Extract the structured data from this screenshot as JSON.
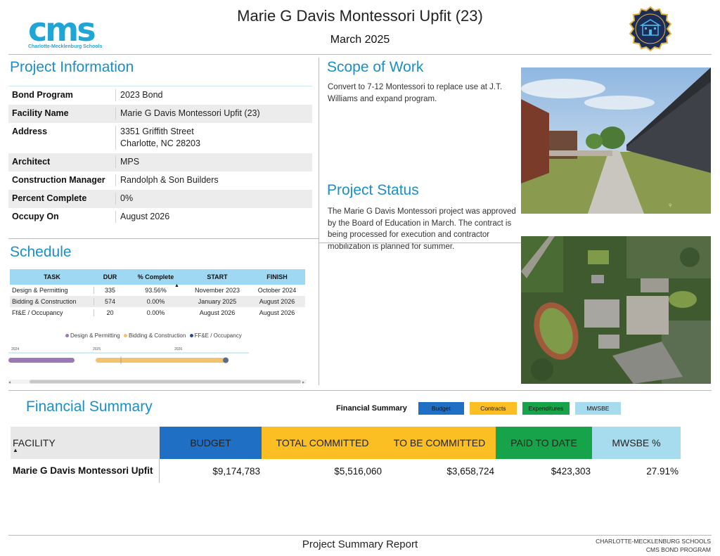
{
  "header": {
    "logo_text": "cms",
    "logo_subtext": "Charlotte-Mecklenburg Schools",
    "title": "Marie G Davis Montessori Upfit (23)",
    "date": "March 2025"
  },
  "project_info": {
    "heading": "Project Information",
    "rows": [
      {
        "label": "Bond Program",
        "value": "2023 Bond"
      },
      {
        "label": "Facility Name",
        "value": "Marie G Davis Montessori Upfit (23)"
      },
      {
        "label": "Address",
        "value": "3351 Griffith Street\nCharlotte, NC 28203"
      },
      {
        "label": "Architect",
        "value": "MPS"
      },
      {
        "label": "Construction Manager",
        "value": "Randolph & Son Builders"
      },
      {
        "label": "Percent Complete",
        "value": "0%"
      },
      {
        "label": "Occupy On",
        "value": "August 2026"
      }
    ]
  },
  "schedule": {
    "heading": "Schedule",
    "columns": [
      "TASK",
      "DUR",
      "% Complete",
      "START",
      "FINISH"
    ],
    "rows": [
      {
        "task": "Design & Permitting",
        "dur": "335",
        "pct": "93.56%",
        "start": "November 2023",
        "finish": "October 2024"
      },
      {
        "task": "Bidding & Construction",
        "dur": "574",
        "pct": "0.00%",
        "start": "January 2025",
        "finish": "August 2026"
      },
      {
        "task": "Ff&E / Occupancy",
        "dur": "20",
        "pct": "0.00%",
        "start": "August 2026",
        "finish": "August 2026"
      }
    ],
    "legend": [
      {
        "label": "Design & Permitting",
        "color": "#9b79b5"
      },
      {
        "label": "Bidding & Construction",
        "color": "#f2c26e"
      },
      {
        "label": "FF&E / Occupancy",
        "color": "#2f4a8a"
      }
    ],
    "timeline_ticks": [
      "2024",
      "2025",
      "2026"
    ]
  },
  "scope": {
    "heading": "Scope of Work",
    "text": "Convert to 7-12 Montessori to replace use at J.T. Williams and expand program."
  },
  "status": {
    "heading": "Project Status",
    "text": "The Marie G Davis Montessori project was approved by the Board of Education in March. The contract is being processed for execution and contractor mobilization is planned for summer."
  },
  "financial": {
    "heading": "Financial Summary",
    "legend_label": "Financial Summary",
    "legend": [
      {
        "label": "Budget",
        "color": "#1f6fc4"
      },
      {
        "label": "Contracts",
        "color": "#fbbf24"
      },
      {
        "label": "Expenditures",
        "color": "#16a34a"
      },
      {
        "label": "MWSBE",
        "color": "#a7dcee"
      }
    ],
    "columns": [
      "FACILITY",
      "BUDGET",
      "TOTAL COMMITTED",
      "TO BE COMMITTED",
      "PAID TO DATE",
      "MWSBE %"
    ],
    "row": {
      "facility": "Marie G Davis Montessori Upfit",
      "budget": "$9,174,783",
      "total_committed": "$5,516,060",
      "to_be_committed": "$3,658,724",
      "paid_to_date": "$423,303",
      "mwsbe": "27.91%"
    }
  },
  "footer": {
    "center": "Project Summary Report",
    "right_line1": "CHARLOTTE-MECKLENBURG SCHOOLS",
    "right_line2": "CMS BOND PROGRAM"
  }
}
